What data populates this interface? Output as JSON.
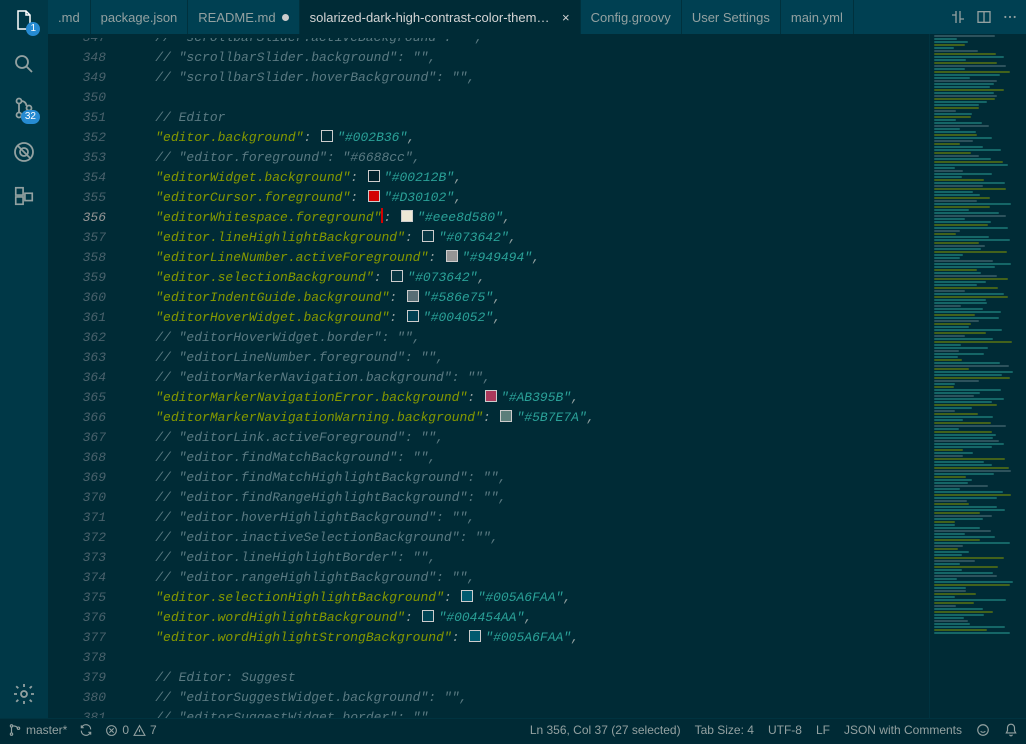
{
  "activity": {
    "explorer_badge": "1",
    "scm_badge": "32"
  },
  "tabs": [
    {
      "label": ".md",
      "active": false,
      "modified": false,
      "closable": false
    },
    {
      "label": "package.json",
      "active": false,
      "modified": false,
      "closable": false
    },
    {
      "label": "README.md",
      "active": false,
      "modified": true,
      "closable": false
    },
    {
      "label": "solarized-dark-high-contrast-color-theme.json",
      "active": true,
      "modified": false,
      "closable": true
    },
    {
      "label": "Config.groovy",
      "active": false,
      "modified": false,
      "closable": false
    },
    {
      "label": "User Settings",
      "active": false,
      "modified": false,
      "closable": false
    },
    {
      "label": "main.yml",
      "active": false,
      "modified": false,
      "closable": false
    }
  ],
  "gutter": {
    "start": 347,
    "end": 381,
    "current": 356,
    "partial_first": true
  },
  "lines": [
    {
      "n": 347,
      "t": "comment",
      "text": "    // \"scrollbarSlider.activeBackground\": \"\","
    },
    {
      "n": 348,
      "t": "comment",
      "text": "    // \"scrollbarSlider.background\": \"\","
    },
    {
      "n": 349,
      "t": "comment",
      "text": "    // \"scrollbarSlider.hoverBackground\": \"\","
    },
    {
      "n": 350,
      "t": "blank",
      "text": ""
    },
    {
      "n": 351,
      "t": "comment",
      "text": "    // Editor"
    },
    {
      "n": 352,
      "t": "kv",
      "key": "editor.background",
      "color": "#002B36",
      "sw": "#002B36"
    },
    {
      "n": 353,
      "t": "comment",
      "text": "    // \"editor.foreground\": \"#6688cc\","
    },
    {
      "n": 354,
      "t": "kv",
      "key": "editorWidget.background",
      "color": "#00212B",
      "sw": "#00212B"
    },
    {
      "n": 355,
      "t": "kv",
      "key": "editorCursor.foreground",
      "color": "#D30102",
      "sw": "#D30102"
    },
    {
      "n": 356,
      "t": "kv",
      "key": "editorWhitespace.foreground",
      "color": "#eee8d580",
      "sw": "#eee8d5",
      "cursor": true
    },
    {
      "n": 357,
      "t": "kv",
      "key": "editor.lineHighlightBackground",
      "color": "#073642",
      "sw": "#073642"
    },
    {
      "n": 358,
      "t": "kv",
      "key": "editorLineNumber.activeForeground",
      "color": "#949494",
      "sw": "#949494"
    },
    {
      "n": 359,
      "t": "kv",
      "key": "editor.selectionBackground",
      "color": "#073642",
      "sw": "#073642"
    },
    {
      "n": 360,
      "t": "kv",
      "key": "editorIndentGuide.background",
      "color": "#586e75",
      "sw": "#586e75"
    },
    {
      "n": 361,
      "t": "kv",
      "key": "editorHoverWidget.background",
      "color": "#004052",
      "sw": "#004052"
    },
    {
      "n": 362,
      "t": "comment",
      "text": "    // \"editorHoverWidget.border\": \"\","
    },
    {
      "n": 363,
      "t": "comment",
      "text": "    // \"editorLineNumber.foreground\": \"\","
    },
    {
      "n": 364,
      "t": "comment",
      "text": "    // \"editorMarkerNavigation.background\": \"\","
    },
    {
      "n": 365,
      "t": "kv",
      "key": "editorMarkerNavigationError.background",
      "color": "#AB395B",
      "sw": "#AB395B"
    },
    {
      "n": 366,
      "t": "kv",
      "key": "editorMarkerNavigationWarning.background",
      "color": "#5B7E7A",
      "sw": "#5B7E7A"
    },
    {
      "n": 367,
      "t": "comment",
      "text": "    // \"editorLink.activeForeground\": \"\","
    },
    {
      "n": 368,
      "t": "comment",
      "text": "    // \"editor.findMatchBackground\": \"\","
    },
    {
      "n": 369,
      "t": "comment",
      "text": "    // \"editor.findMatchHighlightBackground\": \"\","
    },
    {
      "n": 370,
      "t": "comment",
      "text": "    // \"editor.findRangeHighlightBackground\": \"\","
    },
    {
      "n": 371,
      "t": "comment",
      "text": "    // \"editor.hoverHighlightBackground\": \"\","
    },
    {
      "n": 372,
      "t": "comment",
      "text": "    // \"editor.inactiveSelectionBackground\": \"\","
    },
    {
      "n": 373,
      "t": "comment",
      "text": "    // \"editor.lineHighlightBorder\": \"\","
    },
    {
      "n": 374,
      "t": "comment",
      "text": "    // \"editor.rangeHighlightBackground\": \"\","
    },
    {
      "n": 375,
      "t": "kv",
      "key": "editor.selectionHighlightBackground",
      "color": "#005A6FAA",
      "sw": "#005A6F"
    },
    {
      "n": 376,
      "t": "kv",
      "key": "editor.wordHighlightBackground",
      "color": "#004454AA",
      "sw": "#004454"
    },
    {
      "n": 377,
      "t": "kv",
      "key": "editor.wordHighlightStrongBackground",
      "color": "#005A6FAA",
      "sw": "#005A6F"
    },
    {
      "n": 378,
      "t": "blank",
      "text": ""
    },
    {
      "n": 379,
      "t": "comment",
      "text": "    // Editor: Suggest"
    },
    {
      "n": 380,
      "t": "comment",
      "text": "    // \"editorSuggestWidget.background\": \"\","
    },
    {
      "n": 381,
      "t": "comment",
      "text": "    // \"editorSuggestWidget.border\": \"\","
    }
  ],
  "status": {
    "branch": "master*",
    "errors": "0",
    "warnings": "7",
    "cursor": "Ln 356, Col 37 (27 selected)",
    "tabsize": "Tab Size: 4",
    "encoding": "UTF-8",
    "eol": "LF",
    "language": "JSON with Comments"
  }
}
